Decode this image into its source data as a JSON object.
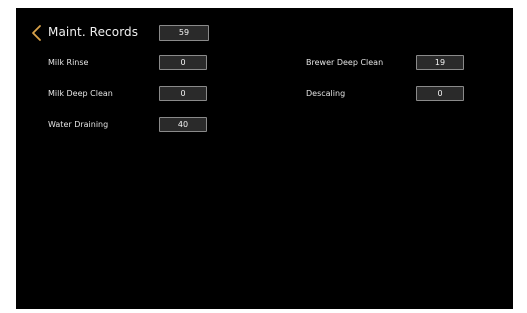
{
  "header": {
    "back_icon": "chevron-left-icon",
    "back_color": "#d9a24a",
    "title": "Maint. Records",
    "total": "59"
  },
  "records": {
    "milk_rinse": {
      "label": "Milk Rinse",
      "value": "0"
    },
    "milk_deep_clean": {
      "label": "Milk Deep Clean",
      "value": "0"
    },
    "water_draining": {
      "label": "Water Draining",
      "value": "40"
    },
    "brewer_deep_clean": {
      "label": "Brewer Deep Clean",
      "value": "19"
    },
    "descaling": {
      "label": "Descaling",
      "value": "0"
    }
  }
}
